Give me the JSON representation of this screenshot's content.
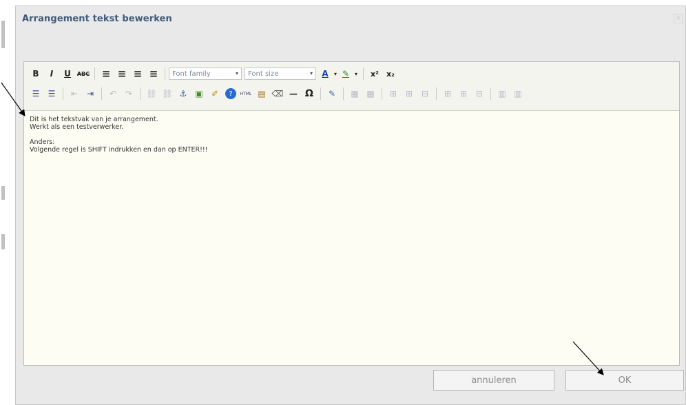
{
  "dialog": {
    "title": "Arrangement tekst bewerken",
    "close_glyph": "×"
  },
  "toolbar": {
    "row1": [
      {
        "icon": "bold-icon",
        "glyph": "B"
      },
      {
        "icon": "italic-icon",
        "glyph": "I"
      },
      {
        "icon": "underline-icon",
        "glyph": "U"
      },
      {
        "icon": "strikethrough-icon",
        "glyph": "ABC"
      },
      {
        "icon": "align-left-icon",
        "glyph": "≡"
      },
      {
        "icon": "align-center-icon",
        "glyph": "≡"
      },
      {
        "icon": "align-right-icon",
        "glyph": "≡"
      },
      {
        "icon": "align-justify-icon",
        "glyph": "≡"
      }
    ],
    "font_family_label": "Font family",
    "font_size_label": "Font size",
    "dropdown_glyph": "▾",
    "row1_tail": [
      {
        "icon": "text-color-icon",
        "glyph": "A"
      },
      {
        "icon": "highlight-color-icon",
        "glyph": "✎"
      },
      {
        "icon": "superscript-icon",
        "glyph": "x²"
      },
      {
        "icon": "subscript-icon",
        "glyph": "x₂"
      }
    ],
    "row2": [
      {
        "icon": "bullet-list-icon",
        "glyph": "☰"
      },
      {
        "icon": "numbered-list-icon",
        "glyph": "☰"
      },
      {
        "icon": "outdent-icon",
        "glyph": "⇤"
      },
      {
        "icon": "indent-icon",
        "glyph": "⇥"
      },
      {
        "icon": "undo-icon",
        "glyph": "↶"
      },
      {
        "icon": "redo-icon",
        "glyph": "↷"
      },
      {
        "icon": "link-icon",
        "glyph": "⛓"
      },
      {
        "icon": "unlink-icon",
        "glyph": "⛓"
      },
      {
        "icon": "anchor-icon",
        "glyph": "⚓"
      },
      {
        "icon": "image-icon",
        "glyph": "▣"
      },
      {
        "icon": "cleanup-icon",
        "glyph": "✐"
      },
      {
        "icon": "help-icon",
        "glyph": "?"
      },
      {
        "icon": "html-icon",
        "glyph": "HTML"
      },
      {
        "icon": "paste-icon",
        "glyph": "▤"
      },
      {
        "icon": "eraser-icon",
        "glyph": "⌫"
      },
      {
        "icon": "horizontal-rule-icon",
        "glyph": "—"
      },
      {
        "icon": "special-char-icon",
        "glyph": "Ω"
      },
      {
        "icon": "edit-icon",
        "glyph": "✎"
      },
      {
        "icon": "table-icon",
        "glyph": "▦"
      },
      {
        "icon": "table-props-icon",
        "glyph": "▦"
      },
      {
        "icon": "row-before-icon",
        "glyph": "⊞"
      },
      {
        "icon": "row-after-icon",
        "glyph": "⊞"
      },
      {
        "icon": "delete-row-icon",
        "glyph": "⊟"
      },
      {
        "icon": "col-before-icon",
        "glyph": "⊞"
      },
      {
        "icon": "col-after-icon",
        "glyph": "⊞"
      },
      {
        "icon": "delete-col-icon",
        "glyph": "⊟"
      },
      {
        "icon": "split-cells-icon",
        "glyph": "▥"
      },
      {
        "icon": "merge-cells-icon",
        "glyph": "▥"
      }
    ]
  },
  "content": {
    "lines": [
      "Dit is het tekstvak van je arrangement.",
      "Werkt als een testverwerker.",
      "",
      "Anders:",
      "Volgende regel is SHIFT indrukken en dan op ENTER!!!"
    ]
  },
  "buttons": {
    "cancel_label": "annuleren",
    "ok_label": "OK"
  },
  "colors": {
    "title": "#3f5a7a",
    "editor_bg": "#fdfdf4",
    "dialog_bg": "#e9e9e9"
  }
}
